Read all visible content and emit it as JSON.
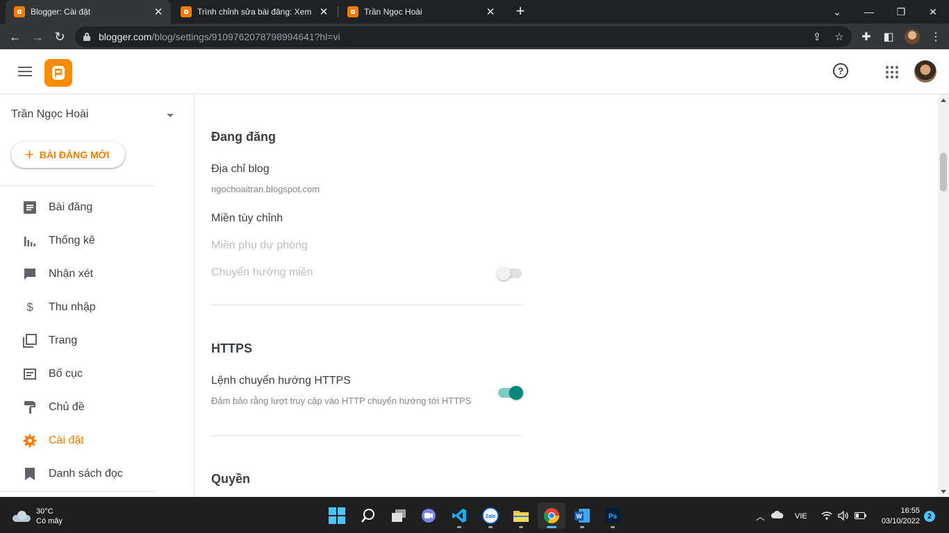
{
  "browser": {
    "tabs": [
      {
        "title": "Blogger: Cài đặt",
        "active": true
      },
      {
        "title": "Trình chỉnh sửa bài đăng: Xem trư",
        "active": false
      },
      {
        "title": "Trần Ngọc Hoài",
        "active": false
      }
    ],
    "url_host": "blogger.com",
    "url_path": "/blog/settings/9109762078798994641?hl=vi"
  },
  "sidebar": {
    "blog_name": "Trần Ngọc Hoài",
    "new_post_label": "BÀI ĐĂNG MỚI",
    "items": [
      {
        "label": "Bài đăng",
        "icon": "posts-icon"
      },
      {
        "label": "Thống kê",
        "icon": "stats-icon"
      },
      {
        "label": "Nhận xét",
        "icon": "comments-icon"
      },
      {
        "label": "Thu nhập",
        "icon": "dollar-icon"
      },
      {
        "label": "Trang",
        "icon": "pages-icon"
      },
      {
        "label": "Bố cục",
        "icon": "layout-icon"
      },
      {
        "label": "Chủ đề",
        "icon": "theme-icon"
      },
      {
        "label": "Cài đặt",
        "icon": "settings-icon",
        "active": true
      },
      {
        "label": "Danh sách đọc",
        "icon": "bookmark-icon"
      }
    ]
  },
  "settings": {
    "publishing": {
      "title": "Đang đăng",
      "blog_address_label": "Địa chỉ blog",
      "blog_address_value": "ngochoaitran.blogspot.com",
      "custom_domain_label": "Miền tùy chỉnh",
      "fallback_domain_label": "Miền phụ dự phòng",
      "redirect_domain_label": "Chuyển hướng miền",
      "redirect_domain_enabled": false
    },
    "https": {
      "title": "HTTPS",
      "redirect_label": "Lệnh chuyển hướng HTTPS",
      "redirect_desc": "Đảm bảo rằng lượt truy cập vào HTTP chuyển hướng tới HTTPS",
      "redirect_enabled": true
    },
    "permissions": {
      "title": "Quyền"
    }
  },
  "taskbar": {
    "temperature": "30°C",
    "weather": "Có mây",
    "language": "VIE",
    "time": "16:55",
    "date": "03/10/2022",
    "notifications": "2"
  },
  "colors": {
    "accent": "#f57c00",
    "toggle_on": "#00897b"
  }
}
